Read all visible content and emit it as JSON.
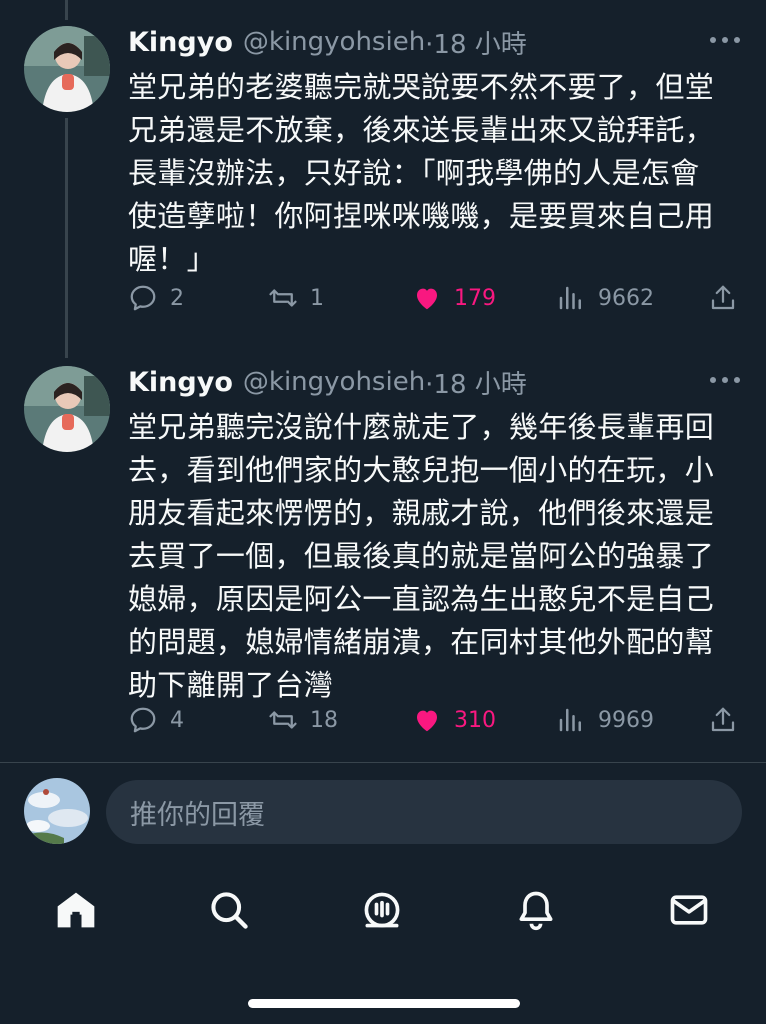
{
  "tweets": [
    {
      "display_name": "Kingyo",
      "handle": "@kingyohsieh",
      "time": "·18 小時",
      "lines": [
        "堂兄弟的老婆聽完就哭說要不然不要了，但堂",
        "兄弟還是不放棄，後來送長輩出來又說拜託，",
        "長輩沒辦法，只好說：「啊我學佛的人是怎會",
        "使造孽啦！你阿捏咪咪嘰嘰，是要買來自己用",
        "喔！」"
      ],
      "replies": "2",
      "retweets": "1",
      "likes": "179",
      "views": "9662"
    },
    {
      "display_name": "Kingyo",
      "handle": "@kingyohsieh",
      "time": "·18 小時",
      "lines": [
        "堂兄弟聽完沒說什麼就走了，幾年後長輩再回",
        "去，看到他們家的大憨兒抱一個小的在玩，小",
        "朋友看起來愣愣的，親戚才說，他們後來還是",
        "去買了一個，但最後真的就是當阿公的強暴了",
        "媳婦，原因是阿公一直認為生出憨兒不是自己",
        "的問題，媳婦情緒崩潰，在同村其他外配的幫",
        "助下離開了台灣"
      ],
      "replies": "4",
      "retweets": "18",
      "likes": "310",
      "views": "9969"
    }
  ],
  "reply_box": {
    "placeholder": "推你的回覆"
  },
  "colors": {
    "background": "#15202b",
    "like": "#f91880",
    "muted": "#8b98a5",
    "text": "#f7f9f9"
  },
  "nav_icons": [
    "home-icon",
    "search-icon",
    "spaces-icon",
    "notifications-icon",
    "messages-icon"
  ]
}
